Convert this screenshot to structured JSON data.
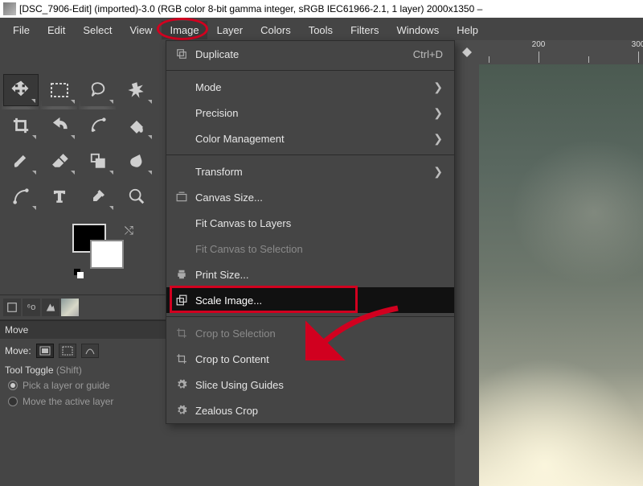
{
  "titlebar": {
    "text": "[DSC_7906-Edit] (imported)-3.0 (RGB color 8-bit gamma integer, sRGB IEC61966-2.1, 1 layer) 2000x1350 –"
  },
  "menubar": {
    "items": [
      "File",
      "Edit",
      "Select",
      "View",
      "Image",
      "Layer",
      "Colors",
      "Tools",
      "Filters",
      "Windows",
      "Help"
    ],
    "active_index": 4
  },
  "image_menu": {
    "duplicate": "Duplicate",
    "duplicate_accel": "Ctrl+D",
    "mode": "Mode",
    "precision": "Precision",
    "color_mgmt": "Color Management",
    "transform": "Transform",
    "canvas_size": "Canvas Size...",
    "fit_layers": "Fit Canvas to Layers",
    "fit_selection": "Fit Canvas to Selection",
    "print_size": "Print Size...",
    "scale_image": "Scale Image...",
    "crop_sel": "Crop to Selection",
    "crop_content": "Crop to Content",
    "slice": "Slice Using Guides",
    "zealous": "Zealous Crop"
  },
  "ruler": {
    "mark1": "200",
    "mark2": "300"
  },
  "options": {
    "title": "Move",
    "label": "Move:",
    "toggle": "Tool Toggle ",
    "toggle_hint": "(Shift)",
    "radio1": "Pick a layer or guide",
    "radio2": "Move the active layer"
  }
}
